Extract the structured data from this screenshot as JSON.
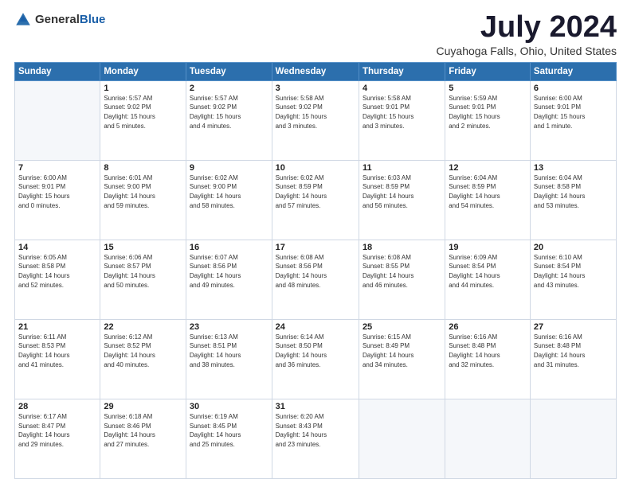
{
  "header": {
    "logo_general": "General",
    "logo_blue": "Blue",
    "month_title": "July 2024",
    "location": "Cuyahoga Falls, Ohio, United States"
  },
  "days_of_week": [
    "Sunday",
    "Monday",
    "Tuesday",
    "Wednesday",
    "Thursday",
    "Friday",
    "Saturday"
  ],
  "weeks": [
    [
      {
        "day": "",
        "info": ""
      },
      {
        "day": "1",
        "info": "Sunrise: 5:57 AM\nSunset: 9:02 PM\nDaylight: 15 hours\nand 5 minutes."
      },
      {
        "day": "2",
        "info": "Sunrise: 5:57 AM\nSunset: 9:02 PM\nDaylight: 15 hours\nand 4 minutes."
      },
      {
        "day": "3",
        "info": "Sunrise: 5:58 AM\nSunset: 9:02 PM\nDaylight: 15 hours\nand 3 minutes."
      },
      {
        "day": "4",
        "info": "Sunrise: 5:58 AM\nSunset: 9:01 PM\nDaylight: 15 hours\nand 3 minutes."
      },
      {
        "day": "5",
        "info": "Sunrise: 5:59 AM\nSunset: 9:01 PM\nDaylight: 15 hours\nand 2 minutes."
      },
      {
        "day": "6",
        "info": "Sunrise: 6:00 AM\nSunset: 9:01 PM\nDaylight: 15 hours\nand 1 minute."
      }
    ],
    [
      {
        "day": "7",
        "info": "Sunrise: 6:00 AM\nSunset: 9:01 PM\nDaylight: 15 hours\nand 0 minutes."
      },
      {
        "day": "8",
        "info": "Sunrise: 6:01 AM\nSunset: 9:00 PM\nDaylight: 14 hours\nand 59 minutes."
      },
      {
        "day": "9",
        "info": "Sunrise: 6:02 AM\nSunset: 9:00 PM\nDaylight: 14 hours\nand 58 minutes."
      },
      {
        "day": "10",
        "info": "Sunrise: 6:02 AM\nSunset: 8:59 PM\nDaylight: 14 hours\nand 57 minutes."
      },
      {
        "day": "11",
        "info": "Sunrise: 6:03 AM\nSunset: 8:59 PM\nDaylight: 14 hours\nand 56 minutes."
      },
      {
        "day": "12",
        "info": "Sunrise: 6:04 AM\nSunset: 8:59 PM\nDaylight: 14 hours\nand 54 minutes."
      },
      {
        "day": "13",
        "info": "Sunrise: 6:04 AM\nSunset: 8:58 PM\nDaylight: 14 hours\nand 53 minutes."
      }
    ],
    [
      {
        "day": "14",
        "info": "Sunrise: 6:05 AM\nSunset: 8:58 PM\nDaylight: 14 hours\nand 52 minutes."
      },
      {
        "day": "15",
        "info": "Sunrise: 6:06 AM\nSunset: 8:57 PM\nDaylight: 14 hours\nand 50 minutes."
      },
      {
        "day": "16",
        "info": "Sunrise: 6:07 AM\nSunset: 8:56 PM\nDaylight: 14 hours\nand 49 minutes."
      },
      {
        "day": "17",
        "info": "Sunrise: 6:08 AM\nSunset: 8:56 PM\nDaylight: 14 hours\nand 48 minutes."
      },
      {
        "day": "18",
        "info": "Sunrise: 6:08 AM\nSunset: 8:55 PM\nDaylight: 14 hours\nand 46 minutes."
      },
      {
        "day": "19",
        "info": "Sunrise: 6:09 AM\nSunset: 8:54 PM\nDaylight: 14 hours\nand 44 minutes."
      },
      {
        "day": "20",
        "info": "Sunrise: 6:10 AM\nSunset: 8:54 PM\nDaylight: 14 hours\nand 43 minutes."
      }
    ],
    [
      {
        "day": "21",
        "info": "Sunrise: 6:11 AM\nSunset: 8:53 PM\nDaylight: 14 hours\nand 41 minutes."
      },
      {
        "day": "22",
        "info": "Sunrise: 6:12 AM\nSunset: 8:52 PM\nDaylight: 14 hours\nand 40 minutes."
      },
      {
        "day": "23",
        "info": "Sunrise: 6:13 AM\nSunset: 8:51 PM\nDaylight: 14 hours\nand 38 minutes."
      },
      {
        "day": "24",
        "info": "Sunrise: 6:14 AM\nSunset: 8:50 PM\nDaylight: 14 hours\nand 36 minutes."
      },
      {
        "day": "25",
        "info": "Sunrise: 6:15 AM\nSunset: 8:49 PM\nDaylight: 14 hours\nand 34 minutes."
      },
      {
        "day": "26",
        "info": "Sunrise: 6:16 AM\nSunset: 8:48 PM\nDaylight: 14 hours\nand 32 minutes."
      },
      {
        "day": "27",
        "info": "Sunrise: 6:16 AM\nSunset: 8:48 PM\nDaylight: 14 hours\nand 31 minutes."
      }
    ],
    [
      {
        "day": "28",
        "info": "Sunrise: 6:17 AM\nSunset: 8:47 PM\nDaylight: 14 hours\nand 29 minutes."
      },
      {
        "day": "29",
        "info": "Sunrise: 6:18 AM\nSunset: 8:46 PM\nDaylight: 14 hours\nand 27 minutes."
      },
      {
        "day": "30",
        "info": "Sunrise: 6:19 AM\nSunset: 8:45 PM\nDaylight: 14 hours\nand 25 minutes."
      },
      {
        "day": "31",
        "info": "Sunrise: 6:20 AM\nSunset: 8:43 PM\nDaylight: 14 hours\nand 23 minutes."
      },
      {
        "day": "",
        "info": ""
      },
      {
        "day": "",
        "info": ""
      },
      {
        "day": "",
        "info": ""
      }
    ]
  ]
}
